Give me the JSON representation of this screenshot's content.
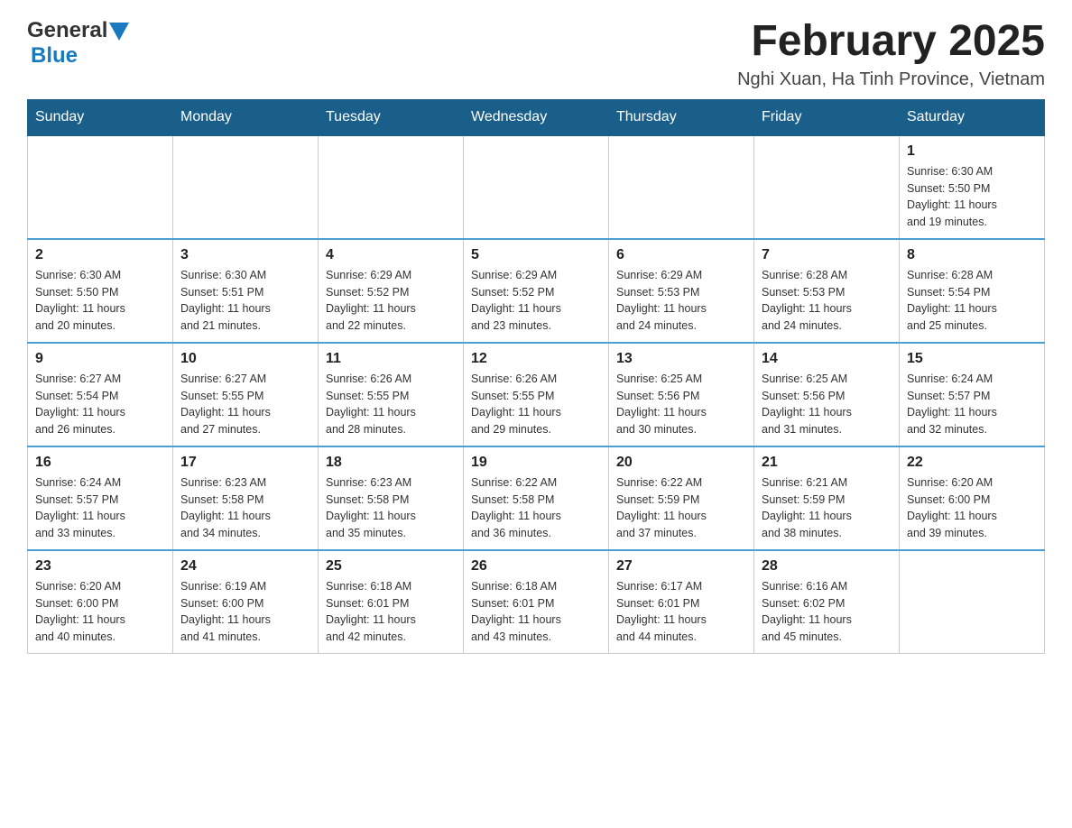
{
  "logo": {
    "general": "General",
    "blue": "Blue"
  },
  "header": {
    "month_year": "February 2025",
    "location": "Nghi Xuan, Ha Tinh Province, Vietnam"
  },
  "days_of_week": [
    "Sunday",
    "Monday",
    "Tuesday",
    "Wednesday",
    "Thursday",
    "Friday",
    "Saturday"
  ],
  "weeks": [
    {
      "days": [
        {
          "num": "",
          "info": ""
        },
        {
          "num": "",
          "info": ""
        },
        {
          "num": "",
          "info": ""
        },
        {
          "num": "",
          "info": ""
        },
        {
          "num": "",
          "info": ""
        },
        {
          "num": "",
          "info": ""
        },
        {
          "num": "1",
          "info": "Sunrise: 6:30 AM\nSunset: 5:50 PM\nDaylight: 11 hours\nand 19 minutes."
        }
      ]
    },
    {
      "days": [
        {
          "num": "2",
          "info": "Sunrise: 6:30 AM\nSunset: 5:50 PM\nDaylight: 11 hours\nand 20 minutes."
        },
        {
          "num": "3",
          "info": "Sunrise: 6:30 AM\nSunset: 5:51 PM\nDaylight: 11 hours\nand 21 minutes."
        },
        {
          "num": "4",
          "info": "Sunrise: 6:29 AM\nSunset: 5:52 PM\nDaylight: 11 hours\nand 22 minutes."
        },
        {
          "num": "5",
          "info": "Sunrise: 6:29 AM\nSunset: 5:52 PM\nDaylight: 11 hours\nand 23 minutes."
        },
        {
          "num": "6",
          "info": "Sunrise: 6:29 AM\nSunset: 5:53 PM\nDaylight: 11 hours\nand 24 minutes."
        },
        {
          "num": "7",
          "info": "Sunrise: 6:28 AM\nSunset: 5:53 PM\nDaylight: 11 hours\nand 24 minutes."
        },
        {
          "num": "8",
          "info": "Sunrise: 6:28 AM\nSunset: 5:54 PM\nDaylight: 11 hours\nand 25 minutes."
        }
      ]
    },
    {
      "days": [
        {
          "num": "9",
          "info": "Sunrise: 6:27 AM\nSunset: 5:54 PM\nDaylight: 11 hours\nand 26 minutes."
        },
        {
          "num": "10",
          "info": "Sunrise: 6:27 AM\nSunset: 5:55 PM\nDaylight: 11 hours\nand 27 minutes."
        },
        {
          "num": "11",
          "info": "Sunrise: 6:26 AM\nSunset: 5:55 PM\nDaylight: 11 hours\nand 28 minutes."
        },
        {
          "num": "12",
          "info": "Sunrise: 6:26 AM\nSunset: 5:55 PM\nDaylight: 11 hours\nand 29 minutes."
        },
        {
          "num": "13",
          "info": "Sunrise: 6:25 AM\nSunset: 5:56 PM\nDaylight: 11 hours\nand 30 minutes."
        },
        {
          "num": "14",
          "info": "Sunrise: 6:25 AM\nSunset: 5:56 PM\nDaylight: 11 hours\nand 31 minutes."
        },
        {
          "num": "15",
          "info": "Sunrise: 6:24 AM\nSunset: 5:57 PM\nDaylight: 11 hours\nand 32 minutes."
        }
      ]
    },
    {
      "days": [
        {
          "num": "16",
          "info": "Sunrise: 6:24 AM\nSunset: 5:57 PM\nDaylight: 11 hours\nand 33 minutes."
        },
        {
          "num": "17",
          "info": "Sunrise: 6:23 AM\nSunset: 5:58 PM\nDaylight: 11 hours\nand 34 minutes."
        },
        {
          "num": "18",
          "info": "Sunrise: 6:23 AM\nSunset: 5:58 PM\nDaylight: 11 hours\nand 35 minutes."
        },
        {
          "num": "19",
          "info": "Sunrise: 6:22 AM\nSunset: 5:58 PM\nDaylight: 11 hours\nand 36 minutes."
        },
        {
          "num": "20",
          "info": "Sunrise: 6:22 AM\nSunset: 5:59 PM\nDaylight: 11 hours\nand 37 minutes."
        },
        {
          "num": "21",
          "info": "Sunrise: 6:21 AM\nSunset: 5:59 PM\nDaylight: 11 hours\nand 38 minutes."
        },
        {
          "num": "22",
          "info": "Sunrise: 6:20 AM\nSunset: 6:00 PM\nDaylight: 11 hours\nand 39 minutes."
        }
      ]
    },
    {
      "days": [
        {
          "num": "23",
          "info": "Sunrise: 6:20 AM\nSunset: 6:00 PM\nDaylight: 11 hours\nand 40 minutes."
        },
        {
          "num": "24",
          "info": "Sunrise: 6:19 AM\nSunset: 6:00 PM\nDaylight: 11 hours\nand 41 minutes."
        },
        {
          "num": "25",
          "info": "Sunrise: 6:18 AM\nSunset: 6:01 PM\nDaylight: 11 hours\nand 42 minutes."
        },
        {
          "num": "26",
          "info": "Sunrise: 6:18 AM\nSunset: 6:01 PM\nDaylight: 11 hours\nand 43 minutes."
        },
        {
          "num": "27",
          "info": "Sunrise: 6:17 AM\nSunset: 6:01 PM\nDaylight: 11 hours\nand 44 minutes."
        },
        {
          "num": "28",
          "info": "Sunrise: 6:16 AM\nSunset: 6:02 PM\nDaylight: 11 hours\nand 45 minutes."
        },
        {
          "num": "",
          "info": ""
        }
      ]
    }
  ]
}
